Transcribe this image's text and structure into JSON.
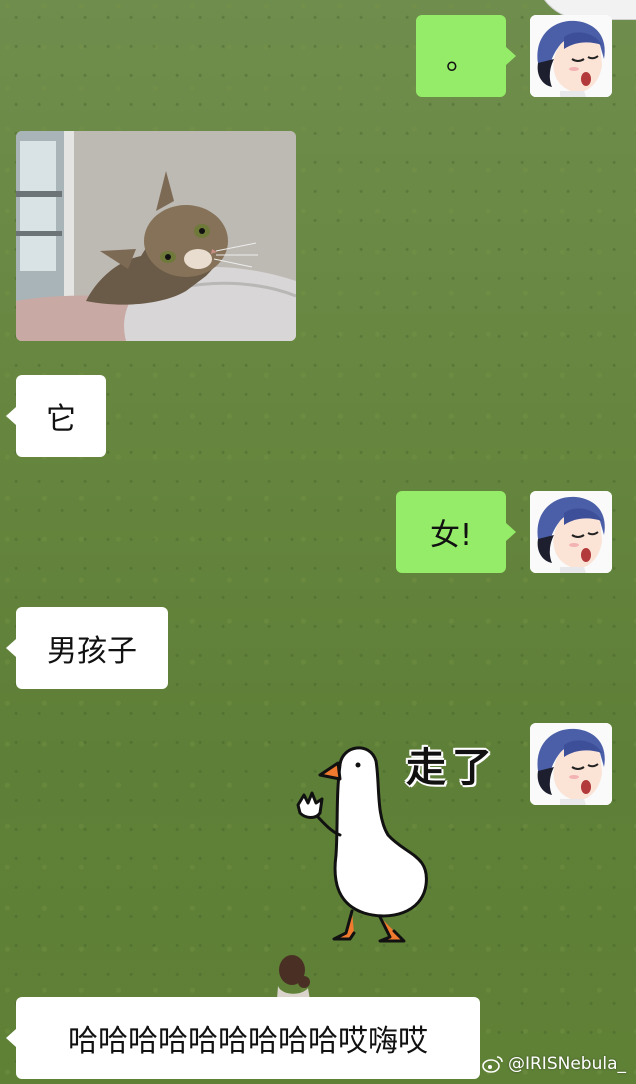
{
  "messages": {
    "m1": {
      "text": "。"
    },
    "m3": {
      "text": "它"
    },
    "m4": {
      "text": "女!"
    },
    "m5": {
      "text": "男孩子"
    },
    "m6": {
      "sticker_text": "走了"
    },
    "m7": {
      "text": "哈哈哈哈哈哈哈哈哈哎嗨哎"
    }
  },
  "watermark": {
    "text": "@IRISNebula_"
  },
  "icons": {
    "avatar": "anime-girl-avatar-icon",
    "photo": "cat-photo",
    "sticker": "goose-sticker-icon",
    "weibo": "weibo-logo-icon"
  },
  "colors": {
    "outgoing_bubble": "#95ec69",
    "incoming_bubble": "#ffffff",
    "background": "#66863f"
  }
}
